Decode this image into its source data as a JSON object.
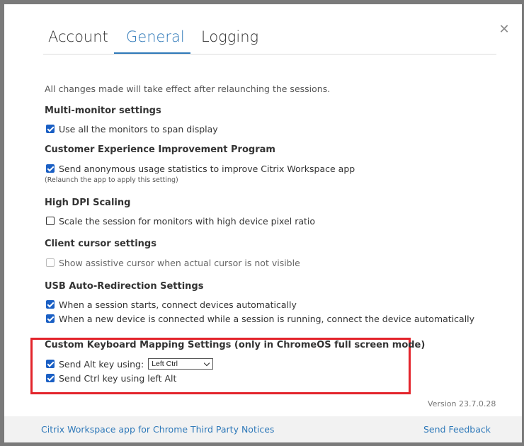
{
  "dialog": {
    "close_symbol": "✕"
  },
  "tabs": [
    {
      "label": "Account",
      "active": false
    },
    {
      "label": "General",
      "active": true
    },
    {
      "label": "Logging",
      "active": false
    }
  ],
  "notice": "All changes made will take effect after relaunching the sessions.",
  "sections": {
    "multi_monitor": {
      "heading": "Multi-monitor settings",
      "option": "Use all the monitors to span display",
      "checked": true
    },
    "ceip": {
      "heading": "Customer Experience Improvement Program",
      "option": "Send anonymous usage statistics to improve Citrix Workspace app",
      "note": "(Relaunch the app to apply this setting)",
      "checked": true
    },
    "high_dpi": {
      "heading": "High DPI Scaling",
      "option": "Scale the session for monitors with high device pixel ratio",
      "checked": false
    },
    "client_cursor": {
      "heading": "Client cursor settings",
      "option": "Show assistive cursor when actual cursor is not visible",
      "checked": false,
      "disabled": true
    },
    "usb": {
      "heading": "USB Auto-Redirection Settings",
      "options": [
        {
          "label": "When a session starts, connect devices automatically",
          "checked": true
        },
        {
          "label": "When a new device is connected while a session is running, connect the device automatically",
          "checked": true
        }
      ]
    },
    "keyboard": {
      "heading": "Custom Keyboard Mapping Settings (only in ChromeOS full screen mode)",
      "alt_label": "Send Alt key using:",
      "alt_select_value": "Left Ctrl",
      "alt_checked": true,
      "ctrl_label": "Send Ctrl key using left Alt",
      "ctrl_checked": true
    }
  },
  "version": "Version 23.7.0.28",
  "footer": {
    "notices_link": "Citrix Workspace app for Chrome Third Party Notices",
    "feedback_link": "Send Feedback"
  },
  "colors": {
    "accent": "#2f79b9",
    "checkbox": "#1a5fc4",
    "highlight": "#e3242b"
  }
}
